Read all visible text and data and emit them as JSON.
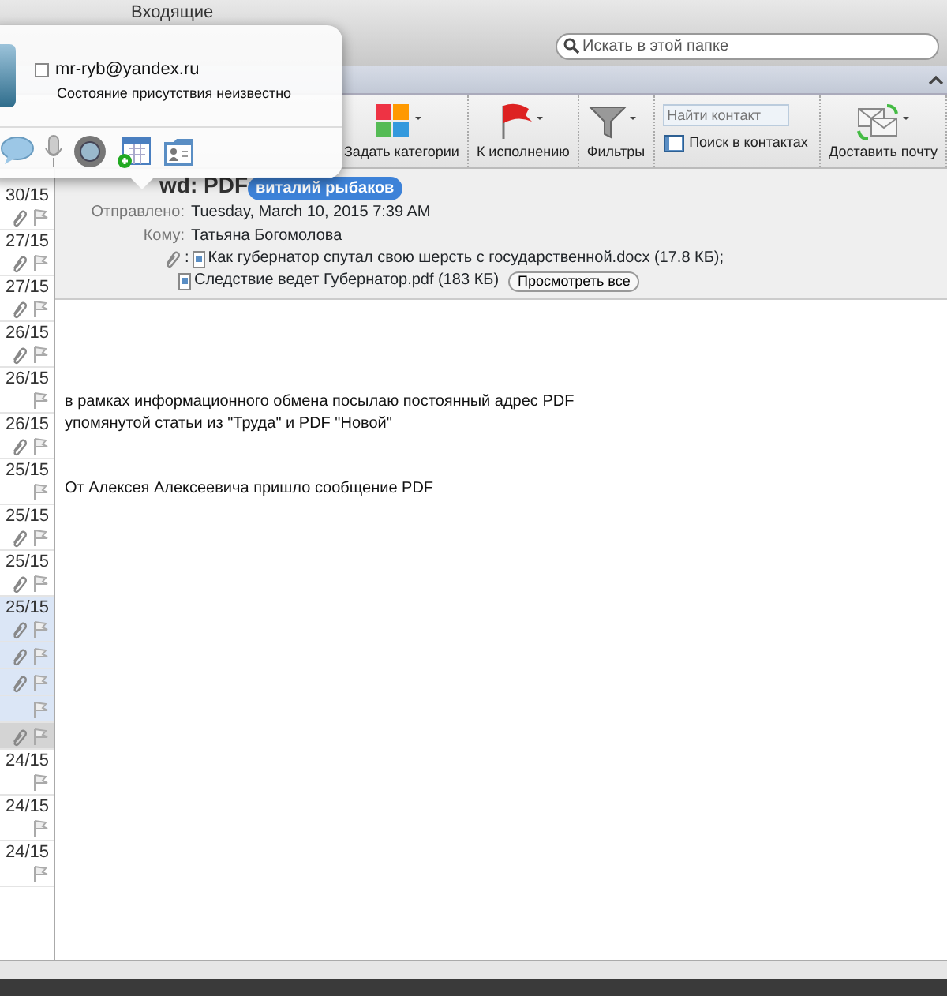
{
  "window": {
    "title": "Входящие"
  },
  "search": {
    "placeholder": "Искать в этой папке"
  },
  "toolbar": {
    "items": [
      {
        "kind": "categories",
        "label": "Задать категории"
      },
      {
        "kind": "flag",
        "label": "К исполнению"
      },
      {
        "kind": "filter",
        "label": "Фильтры"
      },
      {
        "kind": "contact-search",
        "placeholder": "Найти контакт",
        "label": "Поиск в контактах"
      },
      {
        "kind": "send-receive",
        "label": "Доставить почту"
      }
    ]
  },
  "contact_card": {
    "online_checked": false,
    "email": "mr-ryb@yandex.ru",
    "status": "Состояние присутствия неизвестно"
  },
  "messages": [
    {
      "date": "30/15",
      "attachment": true,
      "selected": false,
      "current": false
    },
    {
      "date": "27/15",
      "attachment": true,
      "selected": false,
      "current": false
    },
    {
      "date": "27/15",
      "attachment": true,
      "selected": false,
      "current": false
    },
    {
      "date": "26/15",
      "attachment": true,
      "selected": false,
      "current": false
    },
    {
      "date": "26/15",
      "attachment": false,
      "selected": false,
      "current": false
    },
    {
      "date": "26/15",
      "attachment": true,
      "selected": false,
      "current": false
    },
    {
      "date": "25/15",
      "attachment": false,
      "selected": false,
      "current": false
    },
    {
      "date": "25/15",
      "attachment": true,
      "selected": false,
      "current": false
    },
    {
      "date": "25/15",
      "attachment": true,
      "selected": false,
      "current": false
    },
    {
      "date": "25/15",
      "attachment": true,
      "selected": true,
      "current": false
    },
    {
      "attachment": true,
      "selected": true,
      "current": false
    },
    {
      "attachment": true,
      "selected": true,
      "current": false
    },
    {
      "attachment": false,
      "selected": true,
      "current": false
    },
    {
      "attachment": true,
      "selected": true,
      "current": true
    },
    {
      "date": "24/15",
      "attachment": false,
      "selected": false,
      "current": false
    },
    {
      "date": "24/15",
      "attachment": false,
      "selected": false,
      "current": false
    },
    {
      "date": "24/15",
      "attachment": false,
      "selected": false,
      "current": false
    }
  ],
  "message": {
    "subject": "wd: PDF",
    "sender": "виталий рыбаков",
    "fields": [
      {
        "label": "Отправлено:",
        "value": "Tuesday, March 10, 2015 7:39 AM"
      },
      {
        "label": "Кому:",
        "value": "Татьяна Богомолова"
      }
    ],
    "attachments_label": ":",
    "attachments": [
      {
        "name": "Как губернатор спутал свою шерсть с государственной.docx (17.8 КБ);"
      },
      {
        "name": "Следствие ведет Губернатор.pdf (183 КБ)"
      }
    ],
    "view_all": "Просмотреть все",
    "body": [
      [
        "в рамках информационного обмена посылаю постоянный адрес PDF",
        "упомянутой статьи из \"Труда\" и PDF \"Новой\""
      ],
      [
        "От Алексея Алексеевича пришло сообщение PDF"
      ]
    ]
  }
}
